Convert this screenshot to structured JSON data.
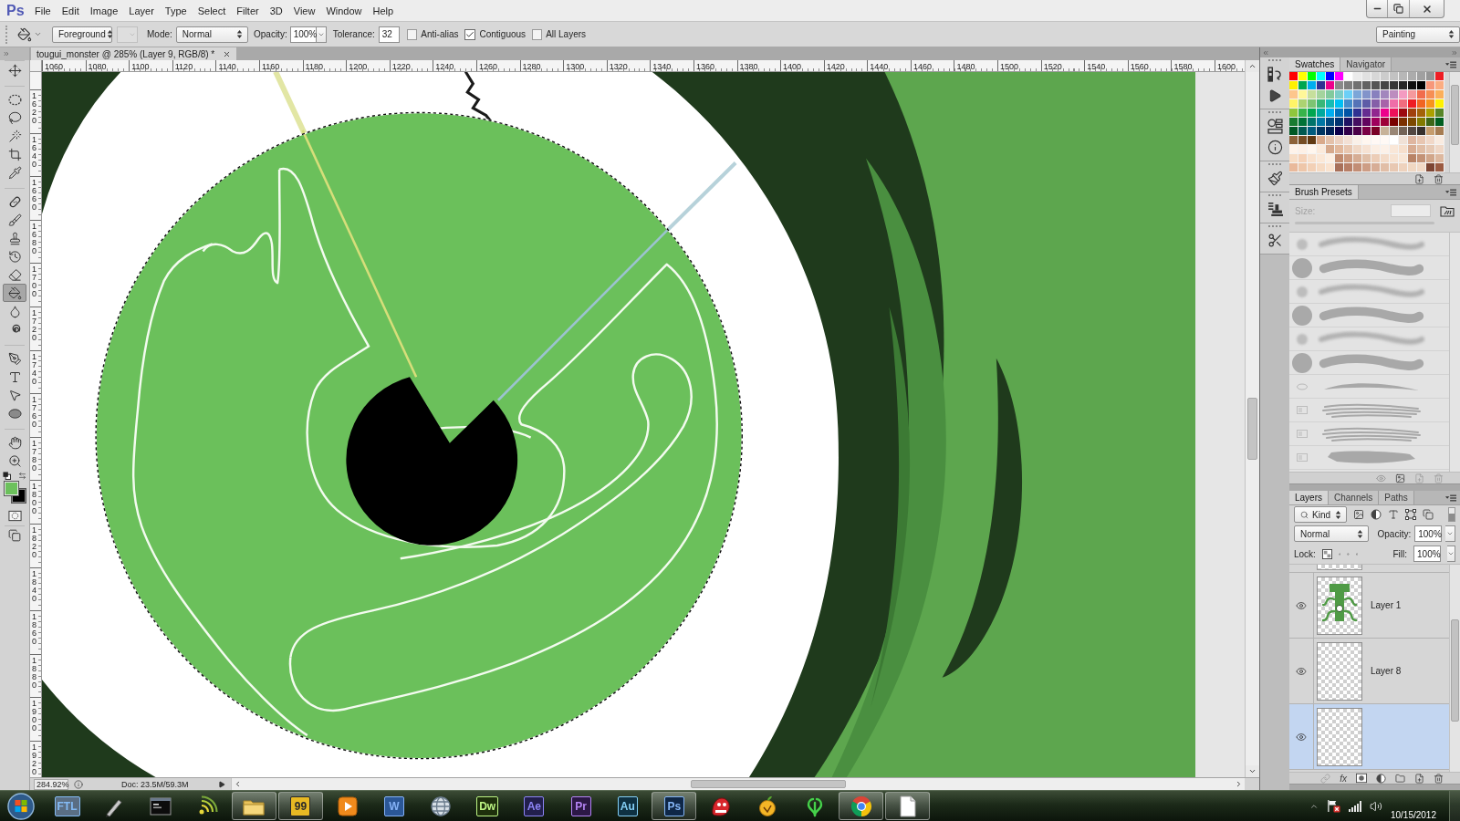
{
  "menu_bar": {
    "logo": "Ps",
    "items": [
      "File",
      "Edit",
      "Image",
      "Layer",
      "Type",
      "Select",
      "Filter",
      "3D",
      "View",
      "Window",
      "Help"
    ]
  },
  "options_bar": {
    "fill_source": "Foreground",
    "pattern_disabled": true,
    "mode_label": "Mode:",
    "mode": "Normal",
    "opacity_label": "Opacity:",
    "opacity": "100%",
    "tolerance_label": "Tolerance:",
    "tolerance": "32",
    "checkboxes": [
      {
        "label": "Anti-alias",
        "checked": false
      },
      {
        "label": "Contiguous",
        "checked": true
      },
      {
        "label": "All Layers",
        "checked": false
      }
    ],
    "workspace": "Painting"
  },
  "toolbar": {
    "tools": [
      {
        "selected": false
      },
      {
        "selected": false
      },
      {
        "selected": false
      },
      {
        "selected": false
      },
      {
        "selected": false
      },
      {
        "selected": false
      },
      {
        "selected": false
      },
      {
        "selected": false
      },
      {
        "selected": false
      },
      {
        "selected": false
      },
      {
        "selected": false
      },
      {
        "selected": true
      },
      {
        "selected": false
      },
      {
        "selected": false
      },
      {
        "selected": false
      },
      {
        "selected": false
      },
      {
        "selected": false
      },
      {
        "selected": false
      },
      {
        "selected": false
      },
      {
        "selected": false
      }
    ],
    "colors": [
      {
        "color": "#6cc15c"
      },
      {
        "color": "#000000"
      }
    ]
  },
  "document": {
    "tab_title": "tougui_monster @ 285% (Layer 9, RGB/8) *",
    "rulers": {
      "horizontal": [
        "1060",
        "1080",
        "1100",
        "1120",
        "1140",
        "1160",
        "1180",
        "1200",
        "1220",
        "1240",
        "1260",
        "1280",
        "1300",
        "1320",
        "1340",
        "1360",
        "1380",
        "1400",
        "1420",
        "1440",
        "1460",
        "1480",
        "1500",
        "1520",
        "1540",
        "1560",
        "1580",
        "1600"
      ],
      "vertical": [
        "1620",
        "1640",
        "1660",
        "1680",
        "1700",
        "1720",
        "1740",
        "1760",
        "1780",
        "1800",
        "1820",
        "1840",
        "1860",
        "1880",
        "1900",
        "1920"
      ]
    },
    "status": {
      "zoom": "284.92%",
      "doc_info": "Doc: 23.5M/59.3M"
    }
  },
  "swatches_panel": {
    "tabs": [
      {
        "label": "Swatches",
        "selected": true
      },
      {
        "label": "Navigator",
        "selected": false
      }
    ],
    "colors": [
      {
        "color": "#ff0000"
      },
      {
        "color": "#ffff00"
      },
      {
        "color": "#00ff00"
      },
      {
        "color": "#00ffff"
      },
      {
        "color": "#0000ff"
      },
      {
        "color": "#ff00ff"
      },
      {
        "color": "#ffffff"
      },
      {
        "color": "#ebebeb"
      },
      {
        "color": "#e1e1e1"
      },
      {
        "color": "#d7d7d7"
      },
      {
        "color": "#cccccc"
      },
      {
        "color": "#c2c2c2"
      },
      {
        "color": "#b7b7b7"
      },
      {
        "color": "#acacac"
      },
      {
        "color": "#a0a0a0"
      },
      {
        "color": "#959595"
      },
      {
        "color": "#ee1d24"
      },
      {
        "color": "#fff100"
      },
      {
        "color": "#00a650"
      },
      {
        "color": "#00aeef"
      },
      {
        "color": "#2f3192"
      },
      {
        "color": "#ed008c"
      },
      {
        "color": "#898989"
      },
      {
        "color": "#7d7d7d"
      },
      {
        "color": "#707070"
      },
      {
        "color": "#626262"
      },
      {
        "color": "#555555"
      },
      {
        "color": "#464646"
      },
      {
        "color": "#363636"
      },
      {
        "color": "#262626"
      },
      {
        "color": "#111111"
      },
      {
        "color": "#000000"
      },
      {
        "color": "#f7977a"
      },
      {
        "color": "#fbad82"
      },
      {
        "color": "#fdc68c"
      },
      {
        "color": "#fff799"
      },
      {
        "color": "#c6df9c"
      },
      {
        "color": "#a4d49d"
      },
      {
        "color": "#81ca9d"
      },
      {
        "color": "#7bcdc9"
      },
      {
        "color": "#6ccff7"
      },
      {
        "color": "#7ca6d8"
      },
      {
        "color": "#8293ca"
      },
      {
        "color": "#8881be"
      },
      {
        "color": "#a286bd"
      },
      {
        "color": "#bc8cbf"
      },
      {
        "color": "#f49bc1"
      },
      {
        "color": "#f5999d"
      },
      {
        "color": "#f16c4d"
      },
      {
        "color": "#f68e54"
      },
      {
        "color": "#fbaf5a"
      },
      {
        "color": "#fff467"
      },
      {
        "color": "#acd372"
      },
      {
        "color": "#7dc473"
      },
      {
        "color": "#39b778"
      },
      {
        "color": "#16bcb4"
      },
      {
        "color": "#00bff3"
      },
      {
        "color": "#438ccb"
      },
      {
        "color": "#5573b7"
      },
      {
        "color": "#5e5ca7"
      },
      {
        "color": "#855fa8"
      },
      {
        "color": "#a763a9"
      },
      {
        "color": "#ef6ea8"
      },
      {
        "color": "#f16d7e"
      },
      {
        "color": "#ee1d24"
      },
      {
        "color": "#f16522"
      },
      {
        "color": "#f7941d"
      },
      {
        "color": "#fff100"
      },
      {
        "color": "#8fc63d"
      },
      {
        "color": "#37b44a"
      },
      {
        "color": "#00a650"
      },
      {
        "color": "#00a99e"
      },
      {
        "color": "#00aeef"
      },
      {
        "color": "#0072bc"
      },
      {
        "color": "#0054a5"
      },
      {
        "color": "#2f3192"
      },
      {
        "color": "#652c91"
      },
      {
        "color": "#91278f"
      },
      {
        "color": "#ed008c"
      },
      {
        "color": "#ee105a"
      },
      {
        "color": "#9d0a0f"
      },
      {
        "color": "#a1410d"
      },
      {
        "color": "#a36209"
      },
      {
        "color": "#aba000"
      },
      {
        "color": "#588528"
      },
      {
        "color": "#197b30"
      },
      {
        "color": "#007236"
      },
      {
        "color": "#00736a"
      },
      {
        "color": "#0076a4"
      },
      {
        "color": "#004a80"
      },
      {
        "color": "#003370"
      },
      {
        "color": "#1d1363"
      },
      {
        "color": "#450e61"
      },
      {
        "color": "#62055f"
      },
      {
        "color": "#9e005c"
      },
      {
        "color": "#9d0039"
      },
      {
        "color": "#790000"
      },
      {
        "color": "#7b3000"
      },
      {
        "color": "#7c4900"
      },
      {
        "color": "#827a00"
      },
      {
        "color": "#3e6617"
      },
      {
        "color": "#005e20"
      },
      {
        "color": "#005824"
      },
      {
        "color": "#005951"
      },
      {
        "color": "#005b7e"
      },
      {
        "color": "#003562"
      },
      {
        "color": "#002056"
      },
      {
        "color": "#0c004b"
      },
      {
        "color": "#30004a"
      },
      {
        "color": "#4b0048"
      },
      {
        "color": "#7a0045"
      },
      {
        "color": "#7a0026"
      },
      {
        "color": "#c7b299"
      },
      {
        "color": "#998675"
      },
      {
        "color": "#736357"
      },
      {
        "color": "#534741"
      },
      {
        "color": "#37302d"
      },
      {
        "color": "#c69c6d"
      },
      {
        "color": "#a67c52"
      },
      {
        "color": "#8c6239"
      },
      {
        "color": "#754c24"
      },
      {
        "color": "#603913"
      },
      {
        "color": "#d9a98a"
      },
      {
        "color": "#e4c1aa"
      },
      {
        "color": "#ecd1c1"
      },
      {
        "color": "#f3e0d4"
      },
      {
        "color": "#faf0e8"
      },
      {
        "color": "#fff6ef"
      },
      {
        "color": "#fff8f4"
      },
      {
        "color": "#fff9f5"
      },
      {
        "color": "#ffffff"
      },
      {
        "color": "#f0e1d6"
      },
      {
        "color": "#dfb6a0"
      },
      {
        "color": "#e8c6b1"
      },
      {
        "color": "#f1d8c8"
      },
      {
        "color": "#f9ebe0"
      },
      {
        "color": "#fef3ea"
      },
      {
        "color": "#fdf0e6"
      },
      {
        "color": "#fff6ee"
      },
      {
        "color": "#fbeadb"
      },
      {
        "color": "#d6a98c"
      },
      {
        "color": "#e2b89c"
      },
      {
        "color": "#e8c7b0"
      },
      {
        "color": "#f0d8c6"
      },
      {
        "color": "#f6e2d3"
      },
      {
        "color": "#fbeee3"
      },
      {
        "color": "#fcf1e8"
      },
      {
        "color": "#f9e7d8"
      },
      {
        "color": "#f6dfcc"
      },
      {
        "color": "#d8ac92"
      },
      {
        "color": "#e0bda5"
      },
      {
        "color": "#e6c9b4"
      },
      {
        "color": "#efd7c6"
      },
      {
        "color": "#f7ddc6"
      },
      {
        "color": "#f5d2b8"
      },
      {
        "color": "#f9e1cd"
      },
      {
        "color": "#fbe8d7"
      },
      {
        "color": "#fdefe2"
      },
      {
        "color": "#c08a6e"
      },
      {
        "color": "#cc9b80"
      },
      {
        "color": "#d6ad94"
      },
      {
        "color": "#e0bfa8"
      },
      {
        "color": "#eccdb7"
      },
      {
        "color": "#f3dbc8"
      },
      {
        "color": "#f7e3d2"
      },
      {
        "color": "#f8e6d6"
      },
      {
        "color": "#b88366"
      },
      {
        "color": "#c39276"
      },
      {
        "color": "#d1a68a"
      },
      {
        "color": "#ddb89f"
      },
      {
        "color": "#e9b99b"
      },
      {
        "color": "#eec6a9"
      },
      {
        "color": "#f2d0b6"
      },
      {
        "color": "#f6dbc4"
      },
      {
        "color": "#fae3cf"
      },
      {
        "color": "#a8705a"
      },
      {
        "color": "#b77e66"
      },
      {
        "color": "#c28d75"
      },
      {
        "color": "#cd9d85"
      },
      {
        "color": "#d7ad96"
      },
      {
        "color": "#e1bea7"
      },
      {
        "color": "#e8c8b2"
      },
      {
        "color": "#eed2bd"
      },
      {
        "color": "#f0d7c2"
      },
      {
        "color": "#f1d9c6"
      },
      {
        "color": "#7d4533"
      },
      {
        "color": "#9b5b42"
      }
    ]
  },
  "brush_presets": {
    "tabs": [
      {
        "label": "Brush Presets",
        "selected": true
      }
    ],
    "size_label": "Size:",
    "size_disabled": true,
    "brushes": [
      {
        "kind": "soft"
      },
      {
        "kind": "hard"
      },
      {
        "kind": "soft"
      },
      {
        "kind": "hard"
      },
      {
        "kind": "soft"
      },
      {
        "kind": "hard"
      },
      {
        "kind": "taper"
      },
      {
        "kind": "bristle"
      },
      {
        "kind": "bristle"
      },
      {
        "kind": "chalk"
      }
    ]
  },
  "layers_panel": {
    "tabs": [
      {
        "label": "Layers",
        "selected": true
      },
      {
        "label": "Channels",
        "selected": false
      },
      {
        "label": "Paths",
        "selected": false
      }
    ],
    "filter": "Kind",
    "blend_mode": "Normal",
    "opacity_label": "Opacity:",
    "opacity": "100%",
    "lock_label": "Lock:",
    "fill_label": "Fill:",
    "fill": "100%",
    "layers": [
      {
        "name": "Layer 1",
        "kind": "art",
        "visible": true,
        "selected": false
      },
      {
        "name": "Layer 8",
        "kind": "empty",
        "visible": true,
        "selected": false
      },
      {
        "kind": "empty",
        "visible": true,
        "selected": true
      }
    ],
    "footer_fx": "fx"
  },
  "taskbar": {
    "apps": [
      {
        "kind": "tile",
        "label": "FTL",
        "color": "#5a6e84",
        "active": false
      },
      {
        "kind": "icon",
        "active": false
      },
      {
        "kind": "icon",
        "active": false
      },
      {
        "kind": "icon",
        "active": false
      },
      {
        "kind": "icon",
        "active": true
      },
      {
        "kind": "tile",
        "label": "99",
        "color": "#e8b923",
        "active": true
      },
      {
        "kind": "icon",
        "active": false
      },
      {
        "kind": "tile",
        "label": "W",
        "color": "#2b5797",
        "active": false
      },
      {
        "kind": "icon",
        "active": false
      },
      {
        "kind": "tile",
        "label": "Dw",
        "color": "#1e300c",
        "active": false
      },
      {
        "kind": "tile",
        "label": "Ae",
        "color": "#221f4d",
        "active": false
      },
      {
        "kind": "tile",
        "label": "Pr",
        "color": "#2c1846",
        "active": false
      },
      {
        "kind": "tile",
        "label": "Au",
        "color": "#0e3142",
        "active": false
      },
      {
        "kind": "tile",
        "label": "Ps",
        "color": "#0f2747",
        "active": true
      },
      {
        "kind": "icon",
        "active": false
      },
      {
        "kind": "icon",
        "active": false
      },
      {
        "kind": "icon",
        "active": false
      },
      {
        "kind": "icon",
        "active": true
      },
      {
        "kind": "icon",
        "active": true
      }
    ],
    "date": "10/15/2012"
  }
}
